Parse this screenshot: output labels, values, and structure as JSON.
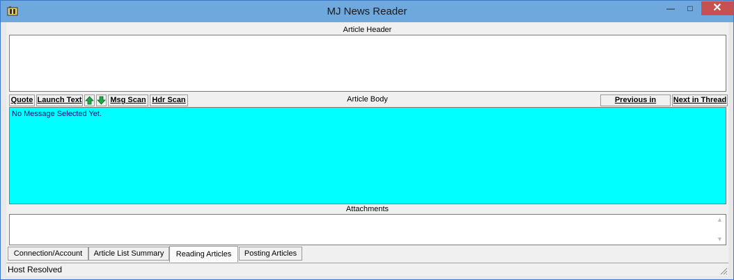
{
  "window": {
    "title": "MJ News Reader"
  },
  "header": {
    "label": "Article Header"
  },
  "toolbar": {
    "quote": "Quote",
    "launch_text": "Launch Text",
    "msg_scan": "Msg Scan",
    "hdr_scan": "Hdr Scan",
    "body_label": "Article Body",
    "prev_thread": "Previous in Thread",
    "next_thread": "Next in Thread"
  },
  "body": {
    "text": "No Message Selected Yet.",
    "background": "#00ffff"
  },
  "attachments": {
    "label": "Attachments"
  },
  "tabs": [
    {
      "label": "Connection/Account"
    },
    {
      "label": "Article List Summary"
    },
    {
      "label": "Reading Articles",
      "active": true
    },
    {
      "label": "Posting Articles"
    }
  ],
  "status": {
    "text": "Host Resolved"
  },
  "colors": {
    "titlebar": "#6ea8dc",
    "close": "#c75050",
    "body": "#00ffff"
  }
}
